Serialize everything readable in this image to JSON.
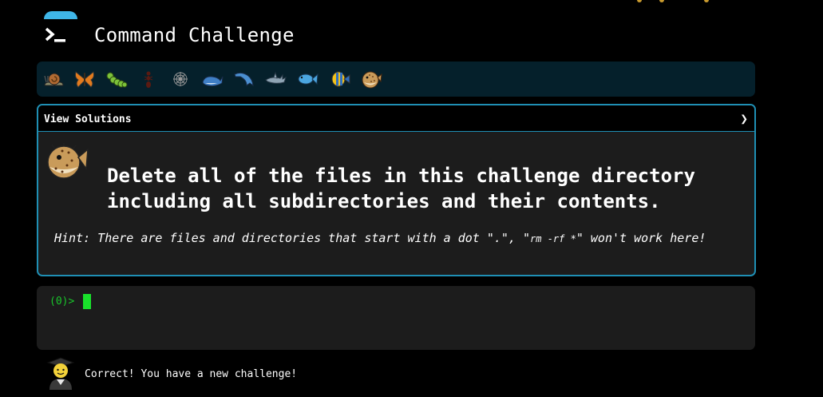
{
  "header": {
    "title": "Command Challenge"
  },
  "emoji_bar": {
    "items": [
      "snail-icon",
      "butterfly-icon",
      "bug-icon",
      "ant-icon",
      "spider-web-icon",
      "whale-icon",
      "dolphin-icon",
      "shark-icon",
      "fish-icon",
      "tropical-fish-icon",
      "blowfish-icon"
    ]
  },
  "challenge": {
    "solutions_label": "View Solutions",
    "solutions_chevron": "❯",
    "text": "Delete all of the files in this challenge directory including all subdirectories and their contents.",
    "hint_prefix": "Hint: There are files and directories that start with a dot \".\", \"",
    "hint_code": "rm -rf *",
    "hint_suffix": "\" won't work here!"
  },
  "terminal": {
    "prompt": "(0)>"
  },
  "status": {
    "message": "Correct! You have a new challenge!"
  },
  "colors": {
    "accent": "#1f8fb4",
    "prompt": "#19c52b",
    "emoji_bar_bg": "#05202b"
  }
}
